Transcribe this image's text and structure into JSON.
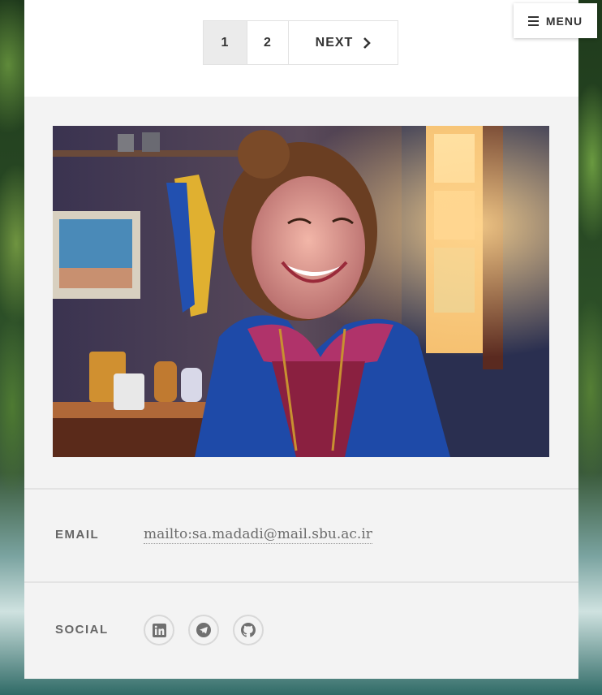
{
  "pagination": {
    "current": "1",
    "page2": "2",
    "next_label": "NEXT"
  },
  "menu": {
    "label": "MENU"
  },
  "email": {
    "label": "EMAIL",
    "value": "mailto:sa.madadi@mail.sbu.ac.ir"
  },
  "social": {
    "label": "SOCIAL",
    "icons": [
      "linkedin-icon",
      "telegram-icon",
      "github-icon"
    ]
  }
}
